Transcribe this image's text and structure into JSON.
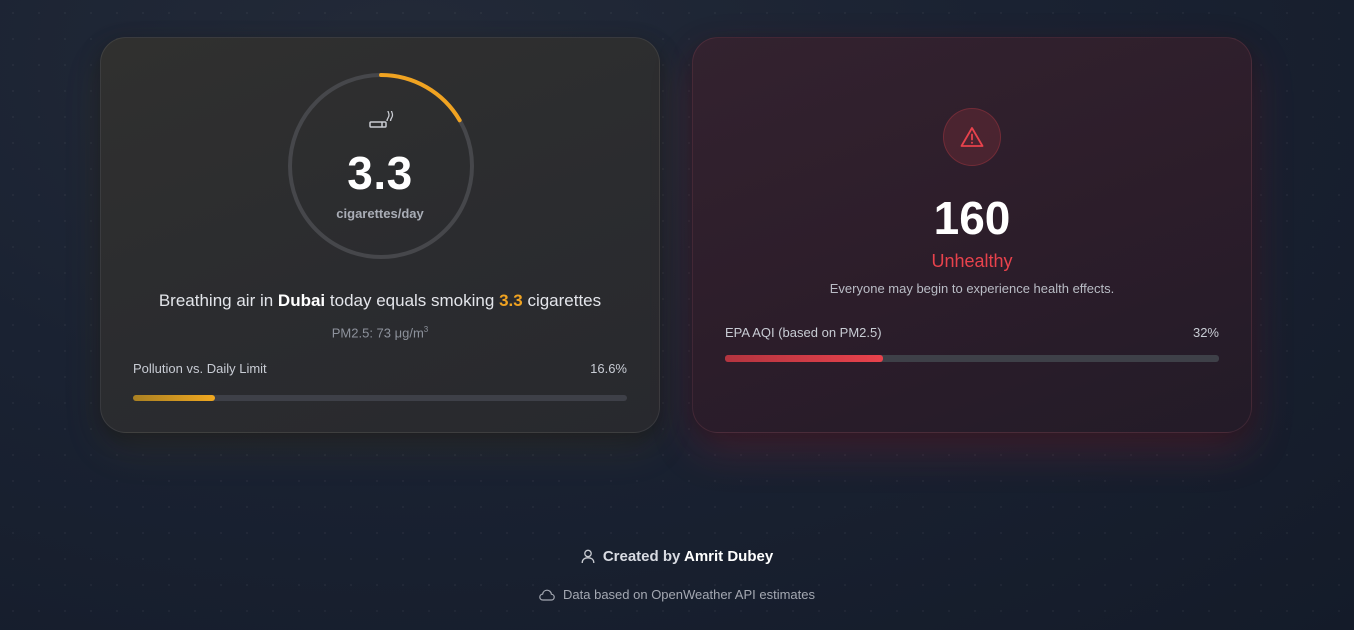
{
  "left_card": {
    "cigarettes_value": "3.3",
    "cigarettes_unit": "cigarettes/day",
    "ring_fraction": 0.166,
    "statement_prefix": "Breathing air in",
    "city": "Dubai",
    "statement_middle": "today equals smoking",
    "statement_value": "3.3",
    "statement_suffix": "cigarettes",
    "pm_label": "PM2.5: 73 μg/m",
    "pm_sup": "3",
    "bar_label": "Pollution vs. Daily Limit",
    "bar_percent_text": "16.6%",
    "bar_fraction": 0.166,
    "accent_color": "#f0a321",
    "icon": "cigarette-icon"
  },
  "right_card": {
    "aqi_value": "160",
    "status": "Unhealthy",
    "description": "Everyone may begin to experience health effects.",
    "bar_label": "EPA AQI (based on PM2.5)",
    "bar_percent_text": "32%",
    "bar_fraction": 0.32,
    "accent_color": "#e8424c",
    "icon": "warning-icon"
  },
  "footer": {
    "created_by": "Created by",
    "author": "Amrit Dubey",
    "data_source": "Data based on OpenWeather API estimates",
    "icons": [
      "user-icon",
      "cloud-icon"
    ]
  }
}
